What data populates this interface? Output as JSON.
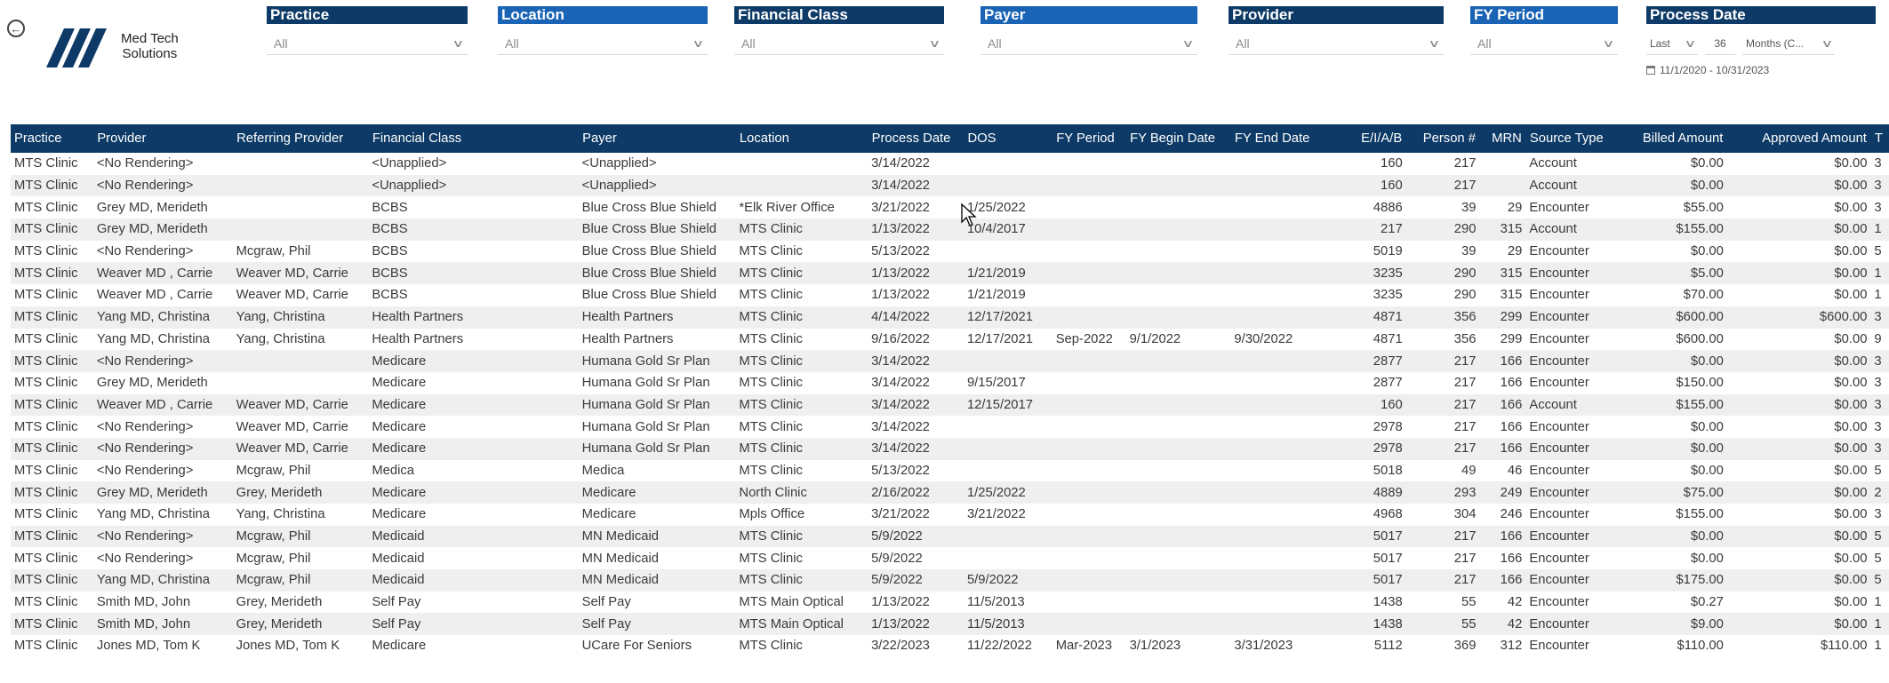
{
  "app": {
    "logo_text_line1": "Med Tech",
    "logo_text_line2": "Solutions",
    "brand_color": "#0d3a66",
    "accent_color": "#1a63b5"
  },
  "slicers": {
    "practice": {
      "label": "Practice",
      "value": "All"
    },
    "location": {
      "label": "Location",
      "value": "All"
    },
    "financial_class": {
      "label": "Financial Class",
      "value": "All"
    },
    "payer": {
      "label": "Payer",
      "value": "All"
    },
    "provider": {
      "label": "Provider",
      "value": "All"
    },
    "fy_period": {
      "label": "FY Period",
      "value": "All"
    },
    "process_date": {
      "label": "Process Date",
      "relative": "Last",
      "count": "36",
      "unit": "Months (C...",
      "range": "11/1/2020 - 10/31/2023"
    }
  },
  "table": {
    "columns": [
      "Practice",
      "Provider",
      "Referring Provider",
      "Financial Class",
      "Payer",
      "Location",
      "Process Date",
      "DOS",
      "FY Period",
      "FY Begin Date",
      "FY End Date",
      "E/I/A/B",
      "Person #",
      "MRN",
      "Source Type",
      "Billed Amount",
      "Approved Amount",
      "T"
    ],
    "rows": [
      [
        "MTS Clinic",
        "<No Rendering>",
        "",
        "<Unapplied>",
        "<Unapplied>",
        "",
        "3/14/2022",
        "",
        "",
        "",
        "",
        "160",
        "217",
        "",
        "Account",
        "$0.00",
        "$0.00",
        "3"
      ],
      [
        "MTS Clinic",
        "<No Rendering>",
        "",
        "<Unapplied>",
        "<Unapplied>",
        "",
        "3/14/2022",
        "",
        "",
        "",
        "",
        "160",
        "217",
        "",
        "Account",
        "$0.00",
        "$0.00",
        "3"
      ],
      [
        "MTS Clinic",
        "Grey MD, Merideth",
        "",
        "BCBS",
        "Blue Cross Blue Shield",
        "*Elk River Office",
        "3/21/2022",
        "1/25/2022",
        "",
        "",
        "",
        "4886",
        "39",
        "29",
        "Encounter",
        "$55.00",
        "$0.00",
        "3"
      ],
      [
        "MTS Clinic",
        "Grey MD, Merideth",
        "",
        "BCBS",
        "Blue Cross Blue Shield",
        "MTS Clinic",
        "1/13/2022",
        "10/4/2017",
        "",
        "",
        "",
        "217",
        "290",
        "315",
        "Account",
        "$155.00",
        "$0.00",
        "1"
      ],
      [
        "MTS Clinic",
        "<No Rendering>",
        "Mcgraw, Phil",
        "BCBS",
        "Blue Cross Blue Shield",
        "MTS Clinic",
        "5/13/2022",
        "",
        "",
        "",
        "",
        "5019",
        "39",
        "29",
        "Encounter",
        "$0.00",
        "$0.00",
        "5"
      ],
      [
        "MTS Clinic",
        "Weaver MD , Carrie",
        "Weaver MD, Carrie",
        "BCBS",
        "Blue Cross Blue Shield",
        "MTS Clinic",
        "1/13/2022",
        "1/21/2019",
        "",
        "",
        "",
        "3235",
        "290",
        "315",
        "Encounter",
        "$5.00",
        "$0.00",
        "1"
      ],
      [
        "MTS Clinic",
        "Weaver MD , Carrie",
        "Weaver MD, Carrie",
        "BCBS",
        "Blue Cross Blue Shield",
        "MTS Clinic",
        "1/13/2022",
        "1/21/2019",
        "",
        "",
        "",
        "3235",
        "290",
        "315",
        "Encounter",
        "$70.00",
        "$0.00",
        "1"
      ],
      [
        "MTS Clinic",
        "Yang MD, Christina",
        "Yang, Christina",
        "Health Partners",
        "Health Partners",
        "MTS Clinic",
        "4/14/2022",
        "12/17/2021",
        "",
        "",
        "",
        "4871",
        "356",
        "299",
        "Encounter",
        "$600.00",
        "$600.00",
        "3"
      ],
      [
        "MTS Clinic",
        "Yang MD, Christina",
        "Yang, Christina",
        "Health Partners",
        "Health Partners",
        "MTS Clinic",
        "9/16/2022",
        "12/17/2021",
        "Sep-2022",
        "9/1/2022",
        "9/30/2022",
        "4871",
        "356",
        "299",
        "Encounter",
        "$600.00",
        "$0.00",
        "9"
      ],
      [
        "MTS Clinic",
        "<No Rendering>",
        "",
        "Medicare",
        "Humana Gold Sr Plan",
        "MTS Clinic",
        "3/14/2022",
        "",
        "",
        "",
        "",
        "2877",
        "217",
        "166",
        "Encounter",
        "$0.00",
        "$0.00",
        "3"
      ],
      [
        "MTS Clinic",
        "Grey MD, Merideth",
        "",
        "Medicare",
        "Humana Gold Sr Plan",
        "MTS Clinic",
        "3/14/2022",
        "9/15/2017",
        "",
        "",
        "",
        "2877",
        "217",
        "166",
        "Encounter",
        "$150.00",
        "$0.00",
        "3"
      ],
      [
        "MTS Clinic",
        "Weaver MD , Carrie",
        "Weaver MD, Carrie",
        "Medicare",
        "Humana Gold Sr Plan",
        "MTS Clinic",
        "3/14/2022",
        "12/15/2017",
        "",
        "",
        "",
        "160",
        "217",
        "166",
        "Account",
        "$155.00",
        "$0.00",
        "3"
      ],
      [
        "MTS Clinic",
        "<No Rendering>",
        "Weaver MD, Carrie",
        "Medicare",
        "Humana Gold Sr Plan",
        "MTS Clinic",
        "3/14/2022",
        "",
        "",
        "",
        "",
        "2978",
        "217",
        "166",
        "Encounter",
        "$0.00",
        "$0.00",
        "3"
      ],
      [
        "MTS Clinic",
        "<No Rendering>",
        "Weaver MD, Carrie",
        "Medicare",
        "Humana Gold Sr Plan",
        "MTS Clinic",
        "3/14/2022",
        "",
        "",
        "",
        "",
        "2978",
        "217",
        "166",
        "Encounter",
        "$0.00",
        "$0.00",
        "3"
      ],
      [
        "MTS Clinic",
        "<No Rendering>",
        "Mcgraw, Phil",
        "Medica",
        "Medica",
        "MTS Clinic",
        "5/13/2022",
        "",
        "",
        "",
        "",
        "5018",
        "49",
        "46",
        "Encounter",
        "$0.00",
        "$0.00",
        "5"
      ],
      [
        "MTS Clinic",
        "Grey MD, Merideth",
        "Grey, Merideth",
        "Medicare",
        "Medicare",
        "North Clinic",
        "2/16/2022",
        "1/25/2022",
        "",
        "",
        "",
        "4889",
        "293",
        "249",
        "Encounter",
        "$75.00",
        "$0.00",
        "2"
      ],
      [
        "MTS Clinic",
        "Yang MD, Christina",
        "Yang, Christina",
        "Medicare",
        "Medicare",
        "Mpls Office",
        "3/21/2022",
        "3/21/2022",
        "",
        "",
        "",
        "4968",
        "304",
        "246",
        "Encounter",
        "$155.00",
        "$0.00",
        "3"
      ],
      [
        "MTS Clinic",
        "<No Rendering>",
        "Mcgraw, Phil",
        "Medicaid",
        "MN Medicaid",
        "MTS Clinic",
        "5/9/2022",
        "",
        "",
        "",
        "",
        "5017",
        "217",
        "166",
        "Encounter",
        "$0.00",
        "$0.00",
        "5"
      ],
      [
        "MTS Clinic",
        "<No Rendering>",
        "Mcgraw, Phil",
        "Medicaid",
        "MN Medicaid",
        "MTS Clinic",
        "5/9/2022",
        "",
        "",
        "",
        "",
        "5017",
        "217",
        "166",
        "Encounter",
        "$0.00",
        "$0.00",
        "5"
      ],
      [
        "MTS Clinic",
        "Yang MD, Christina",
        "Mcgraw, Phil",
        "Medicaid",
        "MN Medicaid",
        "MTS Clinic",
        "5/9/2022",
        "5/9/2022",
        "",
        "",
        "",
        "5017",
        "217",
        "166",
        "Encounter",
        "$175.00",
        "$0.00",
        "5"
      ],
      [
        "MTS Clinic",
        "Smith MD, John",
        "Grey, Merideth",
        "Self Pay",
        "Self Pay",
        "MTS Main Optical",
        "1/13/2022",
        "11/5/2013",
        "",
        "",
        "",
        "1438",
        "55",
        "42",
        "Encounter",
        "$0.27",
        "$0.00",
        "1"
      ],
      [
        "MTS Clinic",
        "Smith MD, John",
        "Grey, Merideth",
        "Self Pay",
        "Self Pay",
        "MTS Main Optical",
        "1/13/2022",
        "11/5/2013",
        "",
        "",
        "",
        "1438",
        "55",
        "42",
        "Encounter",
        "$9.00",
        "$0.00",
        "1"
      ],
      [
        "MTS Clinic",
        "Jones MD, Tom K",
        "Jones MD, Tom K",
        "Medicare",
        "UCare For Seniors",
        "MTS Clinic",
        "3/22/2023",
        "11/22/2022",
        "Mar-2023",
        "3/1/2023",
        "3/31/2023",
        "5112",
        "369",
        "312",
        "Encounter",
        "$110.00",
        "$110.00",
        "1"
      ]
    ]
  }
}
